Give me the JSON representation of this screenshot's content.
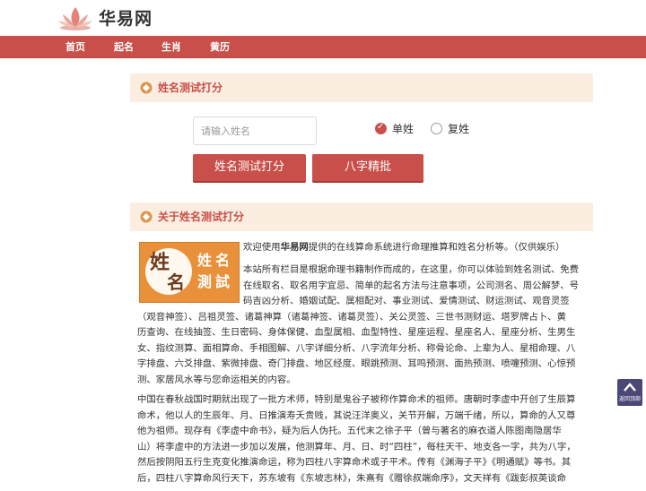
{
  "header": {
    "site_name": "华易网"
  },
  "nav": {
    "items": [
      "首页",
      "起名",
      "生肖",
      "黄历"
    ]
  },
  "test": {
    "title": "姓名测试打分",
    "input_placeholder": "请输入姓名",
    "radio_single": "单姓",
    "radio_double": "复姓",
    "btn_test": "姓名测试打分",
    "btn_bazi": "八字精批"
  },
  "about": {
    "title": "关于姓名测试打分",
    "seal_chars": [
      "姓",
      "名",
      "姓",
      "名",
      "測",
      "試"
    ],
    "line1_pre": "欢迎使用",
    "line1_bold": "华易网",
    "line1_post": "提供的在线算命系统进行命理推算和姓名分析等。（仅供娱乐）",
    "p1_lines": [
      "本站所有栏目是根据命理书籍制作而成的，在这里，你可以体验到姓名测试、免费",
      "在线取名、取名用字宜忌、简单的起名方法与注意事项，公司测名、周公解梦、号",
      "码吉凶分析、婚姻试配、属相配对、事业测试、爱情测试、财运测试、观音灵签",
      "（观音神签）、吕祖灵签、诸葛神算（诸葛神签、诸葛灵签）、关公灵签、三世书测财运、塔罗牌占卜、黄",
      "历查询、在线抽签、生日密码、身体保健、血型属相、血型特性、星座运程、星座名人、星座分析、生男生",
      "女、指纹测算、面相算命、手相图解、八字详细分析、八字流年分析、称骨论命、上辈为人、星相命理、八",
      "字排盘、六爻排盘、紫微排盘、奇门排盘、地区经度、眼跳预测、耳鸣预测、面热预测、喷嚏预测、心惊预",
      "测、家居风水等与您命运相关的内容。"
    ],
    "p2_lines": [
      "中国在春秋战国时期就出现了一批方术师，特别是鬼谷子被称作算命术的祖师。唐朝时李虚中开创了生辰算",
      "命术，他以人的生辰年、月、日推演寿夭贵贱，其说汪洋奥义，关节开解，万端千绪，所以，算命的人又尊",
      "他为祖师。现存有《李虚中命书》，疑为后人伪托。五代末之徐子平（曾与著名的麻衣道人陈图南隐居华",
      "山）将李虚中的方法进一步加以发展，他测算年、月、日、时“四柱”，每柱天干、地支各一字，共为八字，",
      "然后按阴阳五行生克变化推演命运，称为四柱八字算命术或子平术。传有《渊海子平》《明通赋》等书。其",
      "后，四柱八字算命风行天下，苏东坡有《东坡志林》，朱熹有《赠徐叔端命序》，文天祥有《跋彭叔英谈命"
    ]
  },
  "back_top": {
    "label": "返回顶部"
  }
}
